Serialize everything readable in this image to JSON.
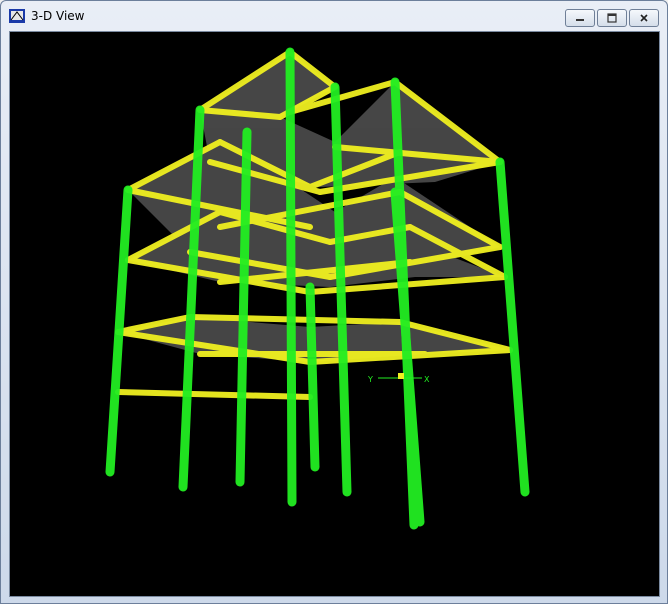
{
  "window": {
    "title": "3-D View",
    "controls": [
      "minimize",
      "maximize",
      "close"
    ]
  },
  "viewport": {
    "background": "#000000",
    "column_color": "#22ee22",
    "beam_color": "#f0f020",
    "slab_color": "#6b6b6b",
    "axis": {
      "y_label": "Y",
      "x_label": "X"
    }
  },
  "icons": {
    "app": "app-icon",
    "minimize": "minimize-icon",
    "maximize": "maximize-icon",
    "close": "close-icon"
  }
}
